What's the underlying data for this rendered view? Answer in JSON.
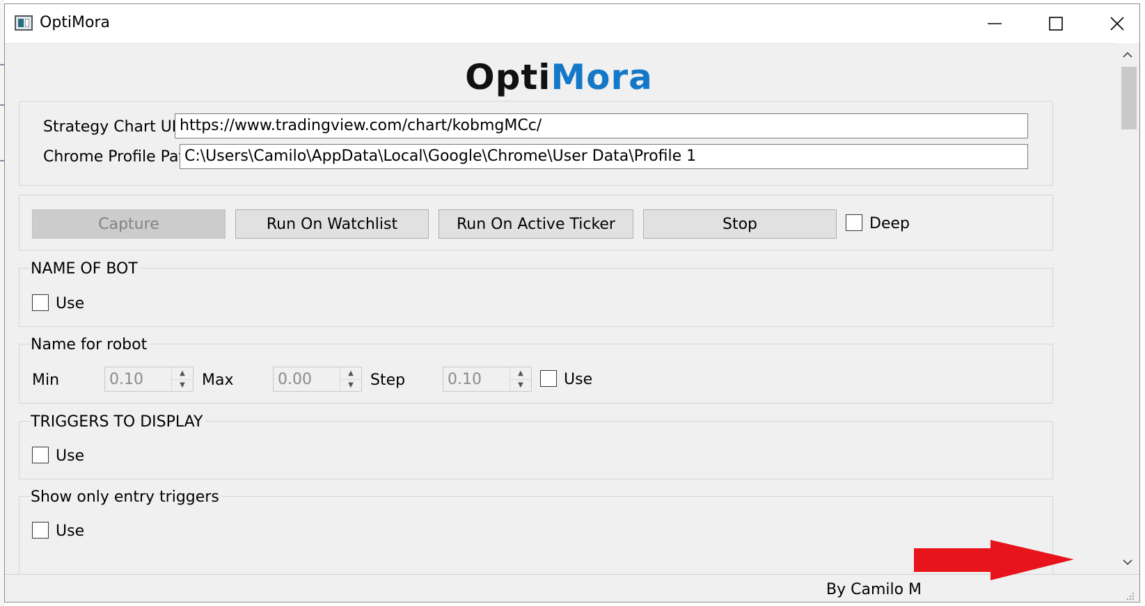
{
  "window": {
    "title": "OptiMora"
  },
  "logo": {
    "part1": "Opti",
    "part2": "Mora",
    "color_part1": "#111111",
    "color_part2": "#1478c8"
  },
  "settings": {
    "strategy_url_label": "Strategy Chart URL",
    "strategy_url_value": "https://www.tradingview.com/chart/kobmgMCc/",
    "chrome_profile_label": "Chrome Profile Path",
    "chrome_profile_value": "C:\\Users\\Camilo\\AppData\\Local\\Google\\Chrome\\User Data\\Profile 1"
  },
  "actions": {
    "capture": "Capture",
    "run_watchlist": "Run On Watchlist",
    "run_active": "Run On  Active Ticker",
    "stop": "Stop",
    "deep": "Deep"
  },
  "groups": {
    "name_of_bot": {
      "title": "NAME OF BOT",
      "use_label": "Use"
    },
    "name_for_robot": {
      "title": "Name for robot",
      "min_label": "Min",
      "min_value": "0.10",
      "max_label": "Max",
      "max_value": "0.00",
      "step_label": "Step",
      "step_value": "0.10",
      "use_label": "Use"
    },
    "triggers_to_display": {
      "title": "TRIGGERS TO DISPLAY",
      "use_label": "Use"
    },
    "show_only_entry": {
      "title": "Show only entry triggers",
      "use_label": "Use"
    }
  },
  "status": {
    "text": "By Camilo M"
  },
  "colors": {
    "window_bg": "#f0f0f0",
    "arrow": "#e8141c",
    "disabled_button": "#cccccc"
  }
}
